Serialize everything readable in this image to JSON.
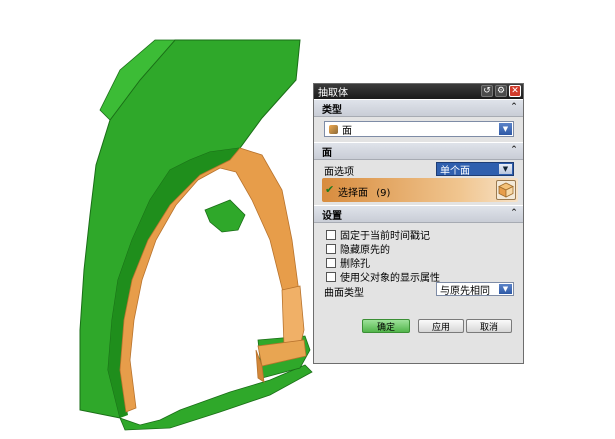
{
  "dialog": {
    "title": "抽取体",
    "type_section": {
      "header": "类型",
      "selected": "面"
    },
    "face_section": {
      "header": "面",
      "face_option_label": "面选项",
      "face_option_value": "单个面",
      "select_face_label": "选择面",
      "select_face_count": "(9)"
    },
    "settings_section": {
      "header": "设置",
      "checkboxes": [
        "固定于当前时间戳记",
        "隐藏原先的",
        "删除孔",
        "使用父对象的显示属性"
      ],
      "surface_type_label": "曲面类型",
      "surface_type_value": "与原先相同"
    },
    "buttons": {
      "ok": "确定",
      "apply": "应用",
      "cancel": "取消"
    }
  },
  "icons": [
    "reset-icon",
    "gear-icon",
    "close-icon",
    "face-type-icon",
    "checkmark-icon",
    "cube-selection-icon",
    "collapse-arrow-icon",
    "dropdown-arrow-icon"
  ],
  "colors": {
    "model_green": "#2fa82a",
    "model_orange": "#e79d4a",
    "titlebar": "#2a2a2a",
    "dialog_bg": "#e3e3e3"
  }
}
